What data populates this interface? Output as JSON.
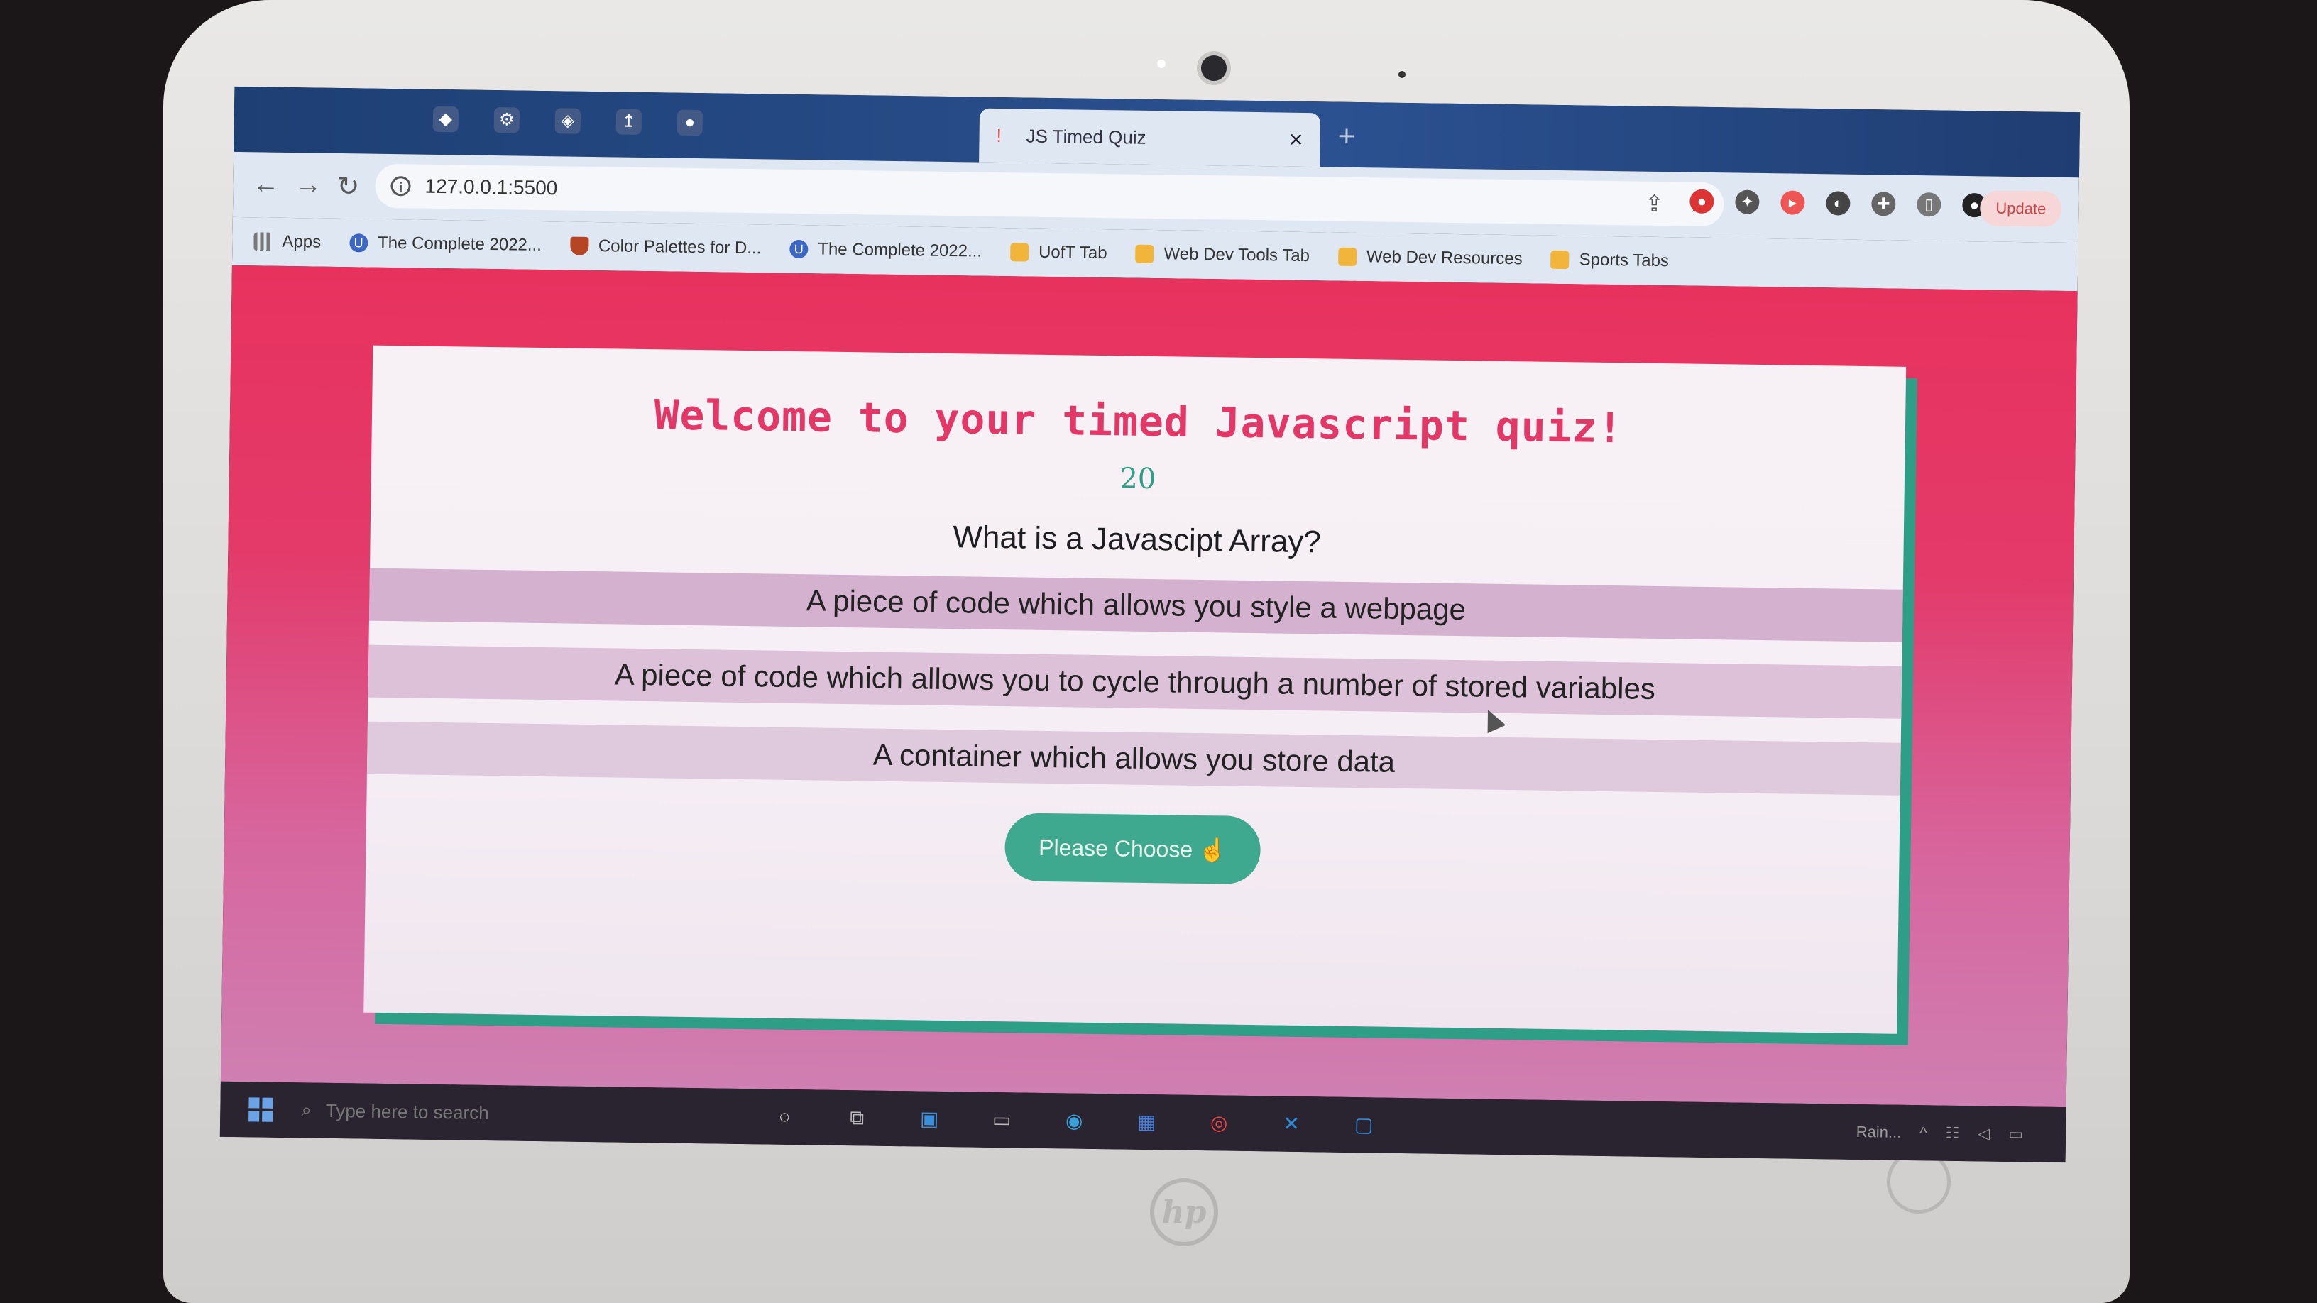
{
  "browser": {
    "active_tab_title": "JS Timed Quiz",
    "url": "127.0.0.1:5500",
    "update_label": "Update",
    "bookmarks": [
      {
        "label": "Apps",
        "icon": "apps-grid-icon"
      },
      {
        "label": "The Complete 2022...",
        "icon": "udemy-icon"
      },
      {
        "label": "Color Palettes for D...",
        "icon": "shield-icon"
      },
      {
        "label": "The Complete 2022...",
        "icon": "udemy-icon"
      },
      {
        "label": "UofT Tab",
        "icon": "folder-icon"
      },
      {
        "label": "Web Dev Tools Tab",
        "icon": "folder-icon"
      },
      {
        "label": "Web Dev Resources",
        "icon": "folder-icon"
      },
      {
        "label": "Sports Tabs",
        "icon": "folder-icon"
      }
    ]
  },
  "quiz": {
    "title": "Welcome to your timed Javascript quiz!",
    "timer": "20",
    "question": "What is a Javascipt Array?",
    "answers": [
      "A piece of code which allows you style a webpage",
      "A piece of code which allows you to cycle through a number of stored variables",
      "A container which allows you store data"
    ],
    "submit_label": "Please Choose"
  },
  "taskbar": {
    "search_placeholder": "Type here to search",
    "weather": "Rain..."
  },
  "colors": {
    "accent_pink": "#e33767",
    "accent_teal": "#3ea98f",
    "page_bg": "#e8325e"
  }
}
